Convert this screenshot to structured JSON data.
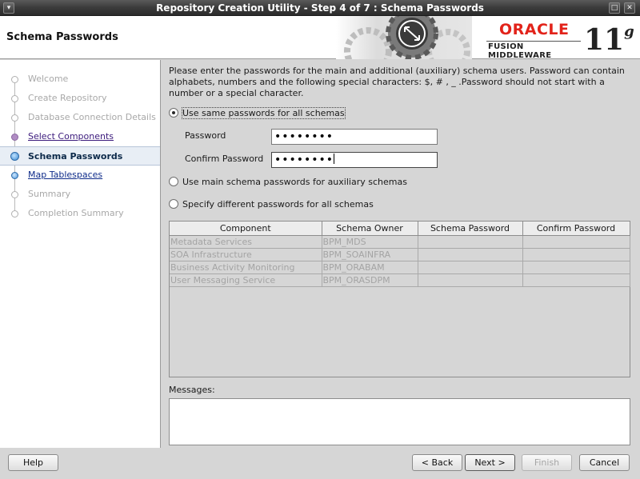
{
  "window": {
    "title": "Repository Creation Utility - Step 4 of 7 : Schema Passwords",
    "controls": [
      "minimize-icon",
      "maximize-icon",
      "close-icon"
    ]
  },
  "header": {
    "page_title": "Schema Passwords",
    "brand": "ORACLE",
    "product": "FUSION MIDDLEWARE",
    "version_number": "11",
    "version_suffix": "g",
    "brand_color": "#e2231a"
  },
  "nav": {
    "steps": [
      {
        "label": "Welcome",
        "state": "done"
      },
      {
        "label": "Create Repository",
        "state": "done"
      },
      {
        "label": "Database Connection Details",
        "state": "done"
      },
      {
        "label": "Select Components",
        "state": "visited-link"
      },
      {
        "label": "Schema Passwords",
        "state": "current"
      },
      {
        "label": "Map Tablespaces",
        "state": "next-link"
      },
      {
        "label": "Summary",
        "state": "pending"
      },
      {
        "label": "Completion Summary",
        "state": "pending"
      }
    ]
  },
  "content": {
    "instructions": "Please enter the passwords for the main and additional (auxiliary) schema users. Password can contain alphabets, numbers and the following special characters: $, # , _ .Password should not start with a number or a special character.",
    "options": {
      "same": "Use same passwords for all schemas",
      "main": "Use main schema passwords for auxiliary schemas",
      "different": "Specify different passwords for all schemas"
    },
    "selected_option": "same",
    "password_label": "Password",
    "password_value": "••••••••",
    "confirm_label": "Confirm Password",
    "confirm_value": "••••••••",
    "table": {
      "columns": [
        "Component",
        "Schema Owner",
        "Schema Password",
        "Confirm Password"
      ],
      "rows": [
        [
          "Metadata Services",
          "BPM_MDS",
          "",
          ""
        ],
        [
          "SOA Infrastructure",
          "BPM_SOAINFRA",
          "",
          ""
        ],
        [
          "Business Activity Monitoring",
          "BPM_ORABAM",
          "",
          ""
        ],
        [
          "User Messaging Service",
          "BPM_ORASDPM",
          "",
          ""
        ]
      ]
    },
    "messages_label": "Messages:"
  },
  "buttons": {
    "help": "Help",
    "back": "< Back",
    "next": "Next >",
    "finish": "Finish",
    "cancel": "Cancel"
  }
}
